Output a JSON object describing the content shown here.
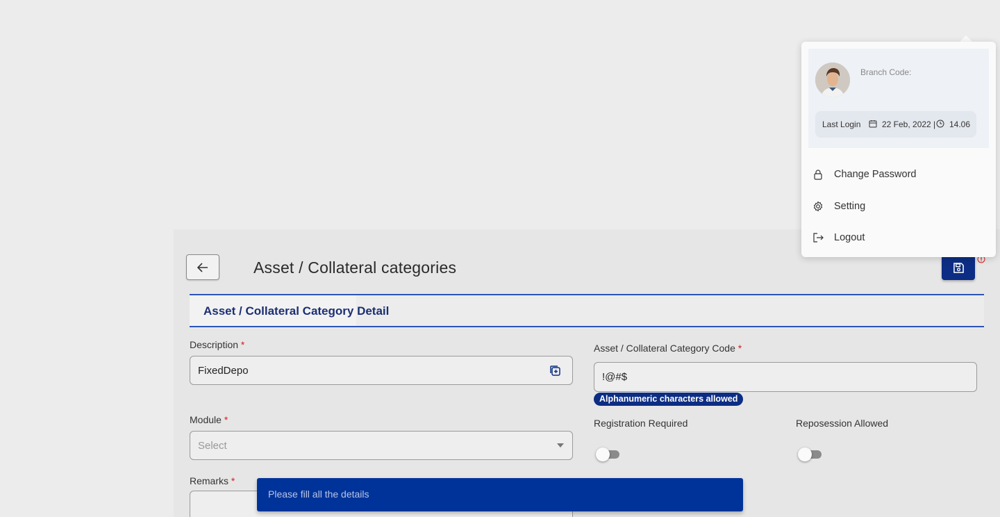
{
  "header": {
    "title": "Asset / Collateral categories"
  },
  "section": {
    "tab_label": "Asset / Collateral Category Detail"
  },
  "form": {
    "description": {
      "label": "Description",
      "required_mark": "*",
      "value": "FixedDepo"
    },
    "category_code": {
      "label": "Asset / Collateral Category Code",
      "required_mark": "*",
      "value": "!@#$",
      "hint": "Alphanumeric characters allowed"
    },
    "module": {
      "label": "Module",
      "required_mark": "*",
      "placeholder": "Select"
    },
    "registration_required": {
      "label": "Registration Required",
      "on": false
    },
    "repossession_allowed": {
      "label": "Reposession Allowed",
      "on": false
    },
    "remarks": {
      "label": "Remarks",
      "required_mark": "*",
      "value": ""
    }
  },
  "toast": {
    "message": "Please fill all the details"
  },
  "profile_menu": {
    "branch_code_label": "Branch Code:",
    "last_login_label": "Last Login",
    "last_login_date": "22 Feb, 2022 |",
    "last_login_time": "14.06",
    "items": [
      {
        "label": "Change Password",
        "icon": "lock-icon"
      },
      {
        "label": "Setting",
        "icon": "gear-icon"
      },
      {
        "label": "Logout",
        "icon": "logout-icon"
      }
    ]
  },
  "colors": {
    "primary": "#0c2d83",
    "toast_bg": "#003399",
    "accent_line": "#2a55b6",
    "required": "#d32020"
  }
}
